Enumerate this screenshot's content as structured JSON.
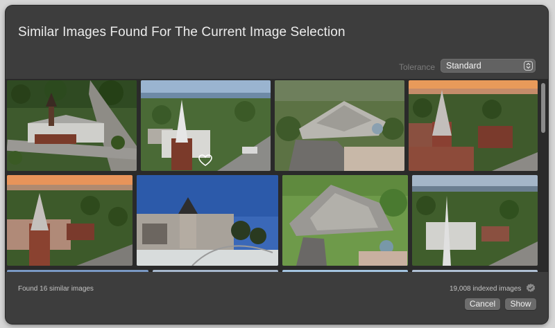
{
  "dialog": {
    "title": "Similar Images Found For The Current Image Selection"
  },
  "tolerance": {
    "label": "Tolerance",
    "selected": "Standard"
  },
  "grid": {
    "images": [
      {
        "name": "aerial-church-wide"
      },
      {
        "name": "church-steeple-favorited",
        "favorited": true
      },
      {
        "name": "church-roof-overhead"
      },
      {
        "name": "steeple-sunset-town"
      },
      {
        "name": "steeple-sunset-closeup"
      },
      {
        "name": "church-street-level"
      },
      {
        "name": "church-roof-green-lawn"
      },
      {
        "name": "steeple-town-river"
      }
    ]
  },
  "status": {
    "found": "Found 16 similar images",
    "indexed": "19,008 indexed images"
  },
  "buttons": {
    "cancel": "Cancel",
    "show": "Show"
  }
}
